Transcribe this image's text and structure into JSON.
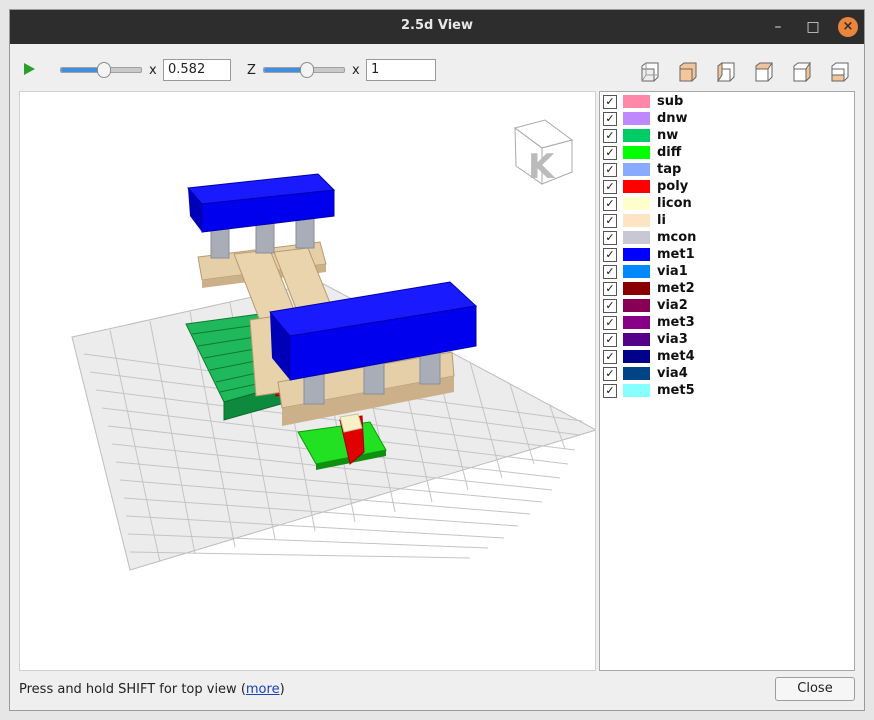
{
  "window": {
    "title": "2.5d View",
    "minimize_icon": "minimize-icon",
    "maximize_icon": "maximize-icon",
    "close_icon": "close-icon"
  },
  "toolbar": {
    "play_icon": "play-icon",
    "scale_x": {
      "label": "x",
      "value": "0.582",
      "slider_fraction": 0.5
    },
    "scale_z": {
      "prefix": "Z",
      "label": "x",
      "value": "1",
      "slider_fraction": 0.5
    },
    "view_buttons": [
      "view-front-icon",
      "view-back-icon",
      "view-left-icon",
      "view-right-icon",
      "view-top-icon",
      "view-bottom-icon"
    ]
  },
  "layers": [
    {
      "name": "sub",
      "color": "#ff88a8",
      "checked": true
    },
    {
      "name": "dnw",
      "color": "#c088ff",
      "checked": true
    },
    {
      "name": "nw",
      "color": "#00cc66",
      "checked": true
    },
    {
      "name": "diff",
      "color": "#00ff00",
      "checked": true
    },
    {
      "name": "tap",
      "color": "#88aaff",
      "checked": true
    },
    {
      "name": "poly",
      "color": "#ff0000",
      "checked": true
    },
    {
      "name": "licon",
      "color": "#ffffcc",
      "checked": true
    },
    {
      "name": "li",
      "color": "#ffe4c4",
      "checked": true
    },
    {
      "name": "mcon",
      "color": "#c8c8d4",
      "checked": true
    },
    {
      "name": "met1",
      "color": "#0000ff",
      "checked": true
    },
    {
      "name": "via1",
      "color": "#0088ff",
      "checked": true
    },
    {
      "name": "met2",
      "color": "#880000",
      "checked": true
    },
    {
      "name": "via2",
      "color": "#880055",
      "checked": true
    },
    {
      "name": "met3",
      "color": "#880088",
      "checked": true
    },
    {
      "name": "via3",
      "color": "#550088",
      "checked": true
    },
    {
      "name": "met4",
      "color": "#000088",
      "checked": true
    },
    {
      "name": "via4",
      "color": "#004488",
      "checked": true
    },
    {
      "name": "met5",
      "color": "#88ffff",
      "checked": true
    }
  ],
  "status": {
    "text": "Press and hold SHIFT for top view (",
    "link": "more",
    "suffix": ")"
  },
  "close_button": "Close"
}
